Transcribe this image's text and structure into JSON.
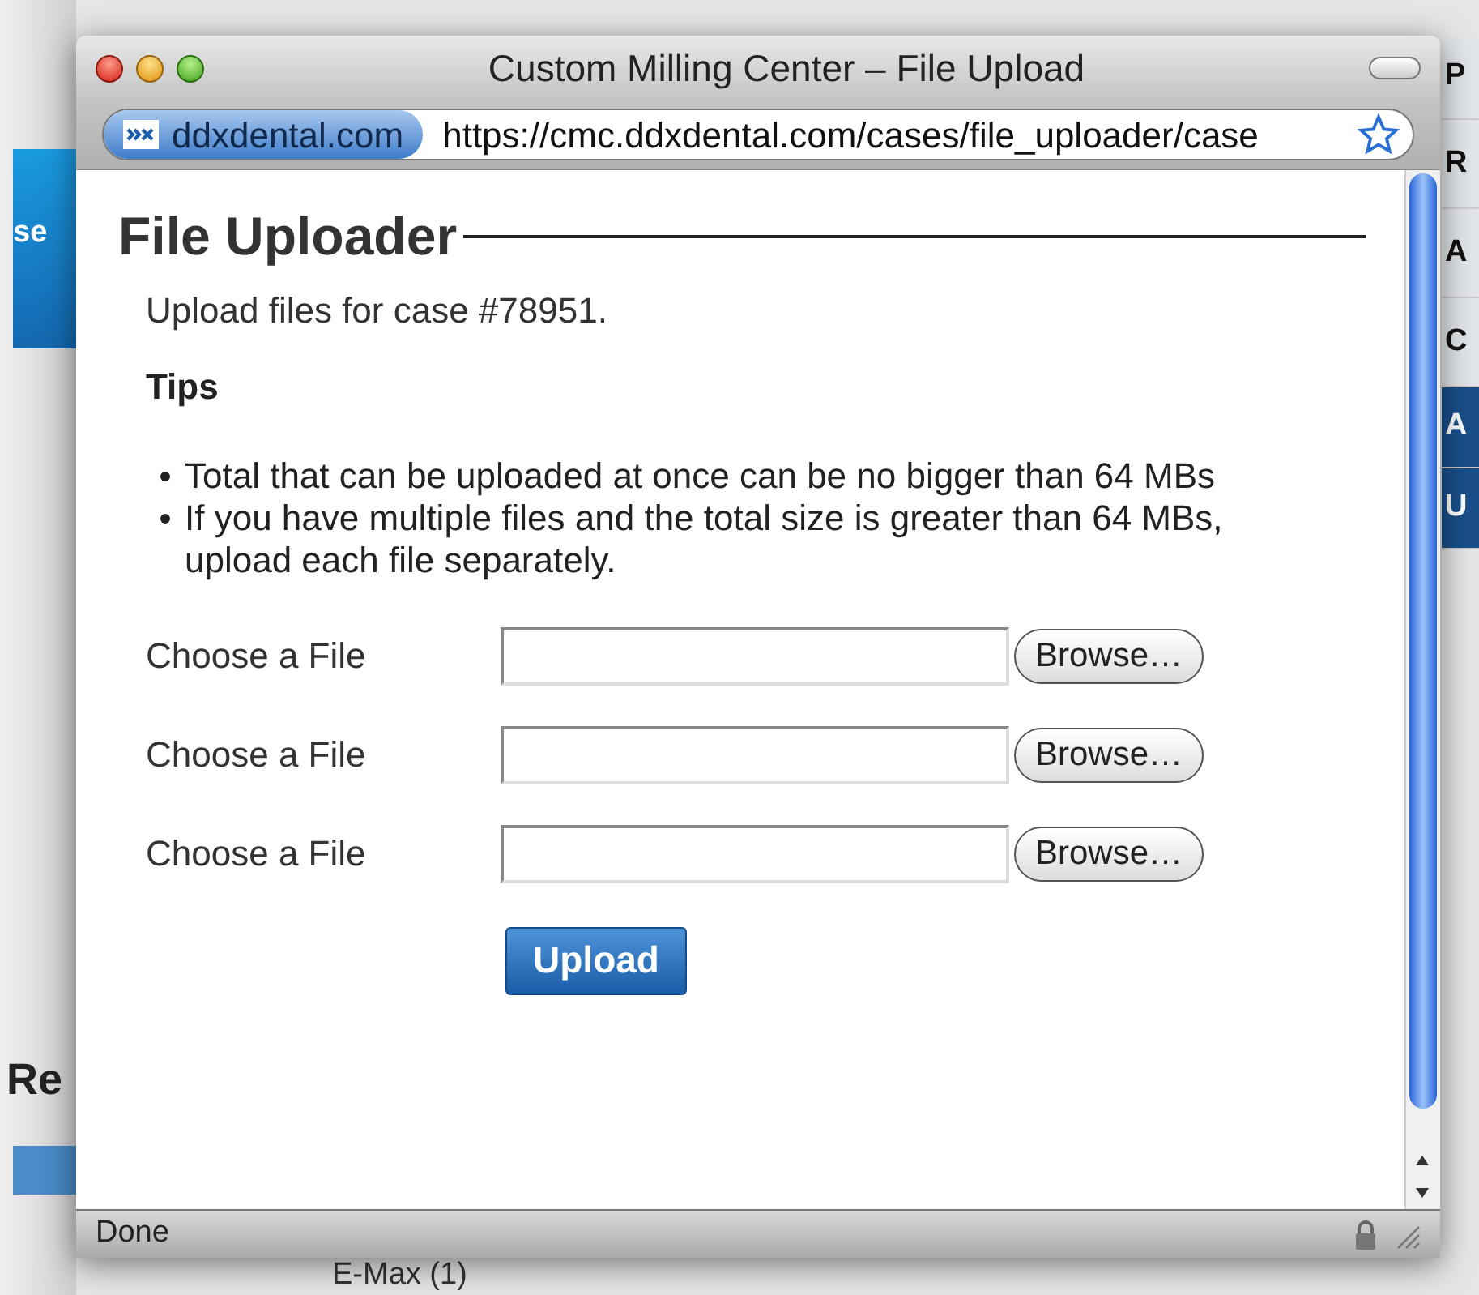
{
  "background_page": {
    "left_texts": [
      "se",
      "Re"
    ],
    "right_tabs": [
      {
        "label": "P",
        "selected": false
      },
      {
        "label": "R",
        "selected": false
      },
      {
        "label": "A",
        "selected": false
      },
      {
        "label": "C",
        "selected": false
      },
      {
        "label": "A",
        "selected": true
      },
      {
        "label": "U",
        "selected": true
      }
    ],
    "bottom_text": "E-Max (1)"
  },
  "window": {
    "title": "Custom Milling Center – File Upload",
    "site_label": "ddxdental.com",
    "url": "https://cmc.ddxdental.com/cases/file_uploader/case"
  },
  "content": {
    "heading": "File Uploader",
    "intro": "Upload files for case #78951.",
    "tips_heading": "Tips",
    "tips": [
      "Total that can be uploaded at once can be no bigger than 64 MBs",
      "If you have multiple files and the total size is greater than 64 MBs, upload each file separately."
    ],
    "file_rows": [
      {
        "label": "Choose a File",
        "button": "Browse…"
      },
      {
        "label": "Choose a File",
        "button": "Browse…"
      },
      {
        "label": "Choose a File",
        "button": "Browse…"
      }
    ],
    "upload_button": "Upload"
  },
  "status_bar": {
    "text": "Done"
  }
}
